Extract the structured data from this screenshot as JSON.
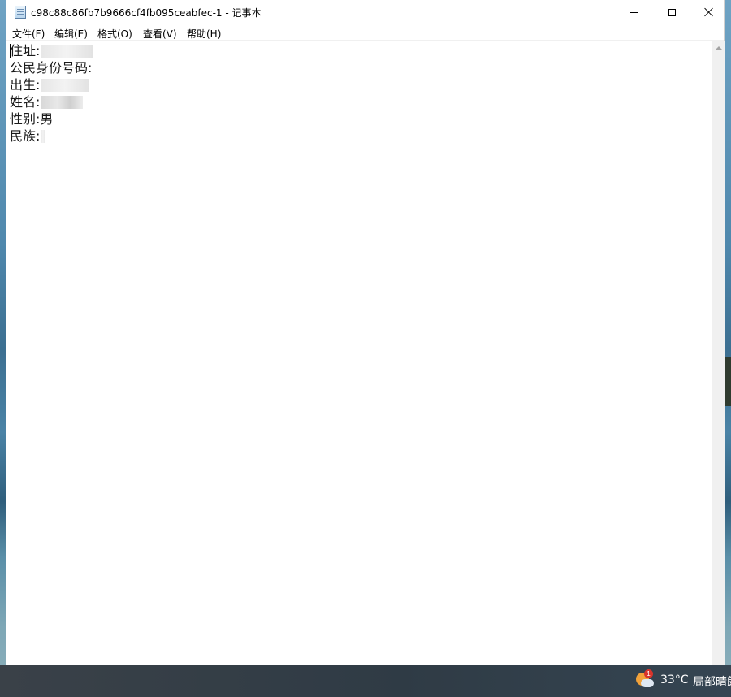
{
  "window": {
    "title": "c98c88c86fb7b9666cf4fb095ceabfec-1 - 记事本"
  },
  "menu": {
    "file": "文件(F)",
    "edit": "编辑(E)",
    "format": "格式(O)",
    "view": "查看(V)",
    "help": "帮助(H)"
  },
  "document": {
    "lines": [
      {
        "label": "住址:",
        "value": ""
      },
      {
        "label": "公民身份号码:",
        "value": ""
      },
      {
        "label": "出生:",
        "value": ""
      },
      {
        "label": "姓名:",
        "value": ""
      },
      {
        "label": "性别:",
        "value": "男"
      },
      {
        "label": "民族:",
        "value": ""
      }
    ]
  },
  "taskbar": {
    "weather": {
      "badge": "1",
      "temperature": "33°C",
      "condition": "局部晴朗"
    }
  }
}
